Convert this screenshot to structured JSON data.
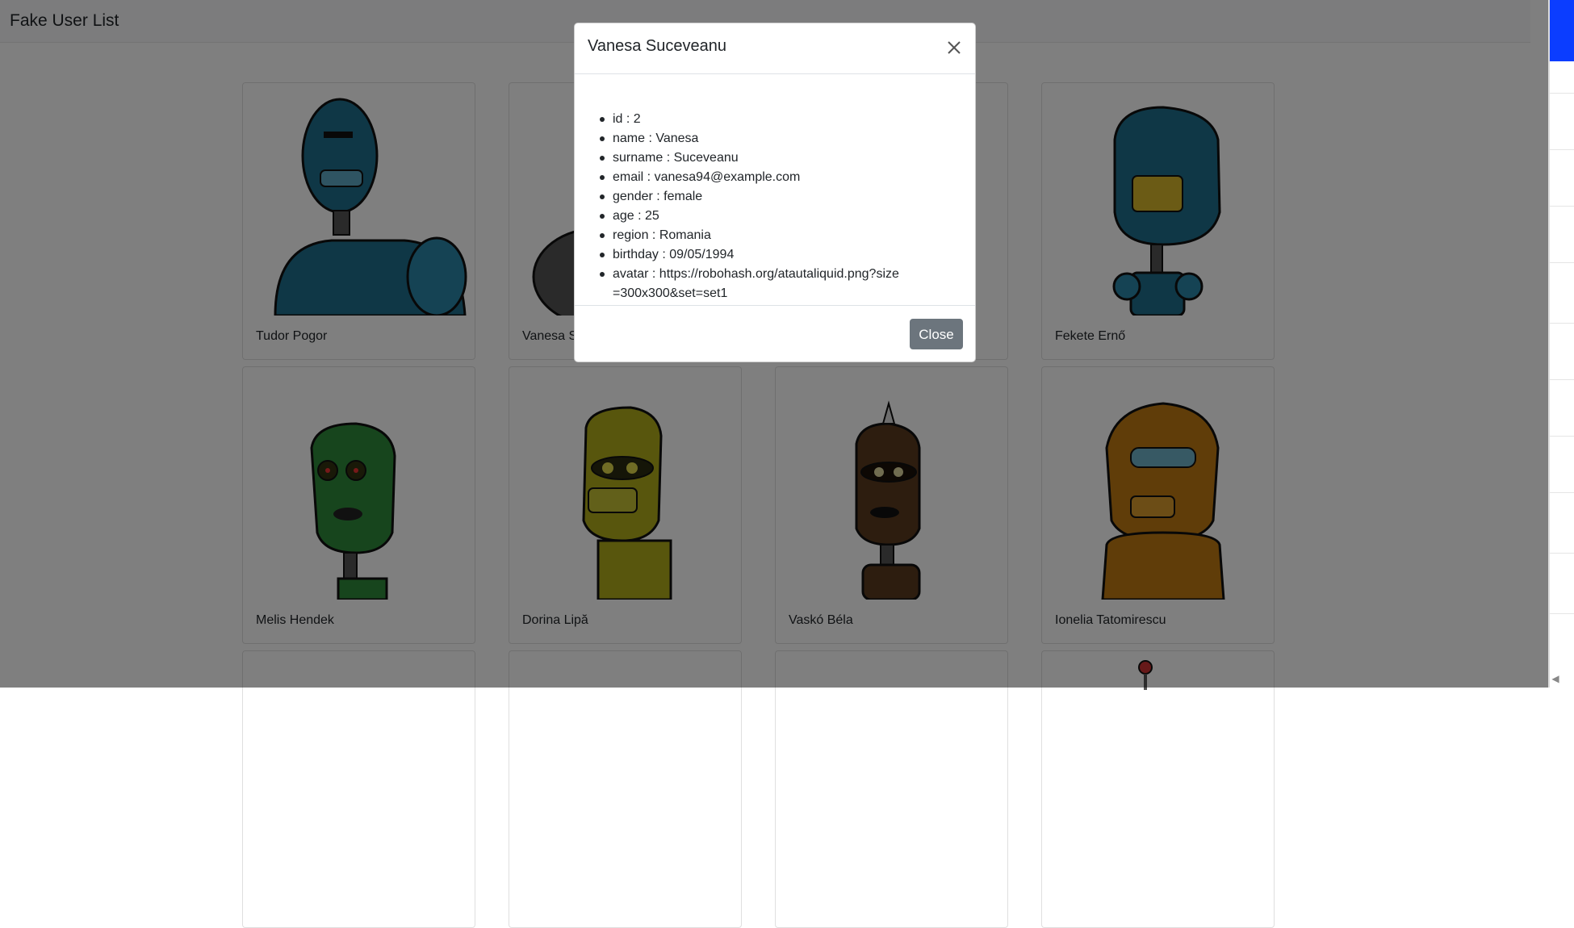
{
  "navbar": {
    "brand": "Fake User List"
  },
  "cards": [
    {
      "name": "Tudor Pogor",
      "color": "#1e6e8c",
      "avatar_icon": "robot-avatar-icon"
    },
    {
      "name": "Vanesa Suceveanu",
      "color": "#555555",
      "avatar_icon": "robot-avatar-icon"
    },
    {
      "name": "",
      "color": "#666666",
      "avatar_icon": "robot-avatar-icon"
    },
    {
      "name": "Fekete Ernő",
      "color": "#1e6e8c",
      "avatar_icon": "robot-avatar-icon"
    },
    {
      "name": "Melis Hendek",
      "color": "#2e8a3a",
      "avatar_icon": "robot-avatar-icon"
    },
    {
      "name": "Dorina Lipă",
      "color": "#b0ad1a",
      "avatar_icon": "robot-avatar-icon"
    },
    {
      "name": "Vaskó Béla",
      "color": "#5a3a1e",
      "avatar_icon": "robot-avatar-icon"
    },
    {
      "name": "Ionelia Tatomirescu",
      "color": "#c07a12",
      "avatar_icon": "robot-avatar-icon"
    }
  ],
  "modal": {
    "title": "Vanesa Suceveanu",
    "details": [
      "id : 2",
      "name : Vanesa",
      "surname : Suceveanu",
      "email : vanesa94@example.com",
      "gender : female",
      "age : 25",
      "region : Romania",
      "birthday : 09/05/1994",
      "avatar : https://robohash.org/atautaliquid.png?size=300x300&set=set1"
    ],
    "close_label": "Close"
  },
  "colors": {
    "backdrop": "rgba(0,0,0,0.5)",
    "button_secondary": "#6c757d",
    "accent_blue": "#0b3dff"
  }
}
